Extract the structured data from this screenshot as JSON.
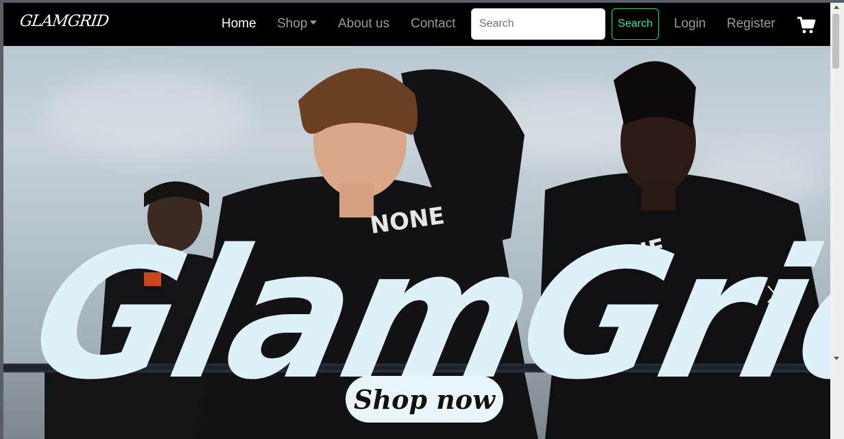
{
  "brand": {
    "name": "GLAMGRID"
  },
  "nav": {
    "home": "Home",
    "shop": "Shop",
    "about": "About us",
    "contact": "Contact",
    "login": "Login",
    "register": "Register"
  },
  "search": {
    "placeholder": "Search",
    "button_label": "Search"
  },
  "hero": {
    "title": "GlamGrid",
    "shop_button": "Shop now"
  },
  "colors": {
    "navbar_bg": "#000000",
    "accent": "#2ee6a8",
    "hero_text": "#dff1f8"
  },
  "icons": {
    "cart": "cart-icon",
    "prev": "chevron-left-icon",
    "next": "chevron-right-icon"
  }
}
